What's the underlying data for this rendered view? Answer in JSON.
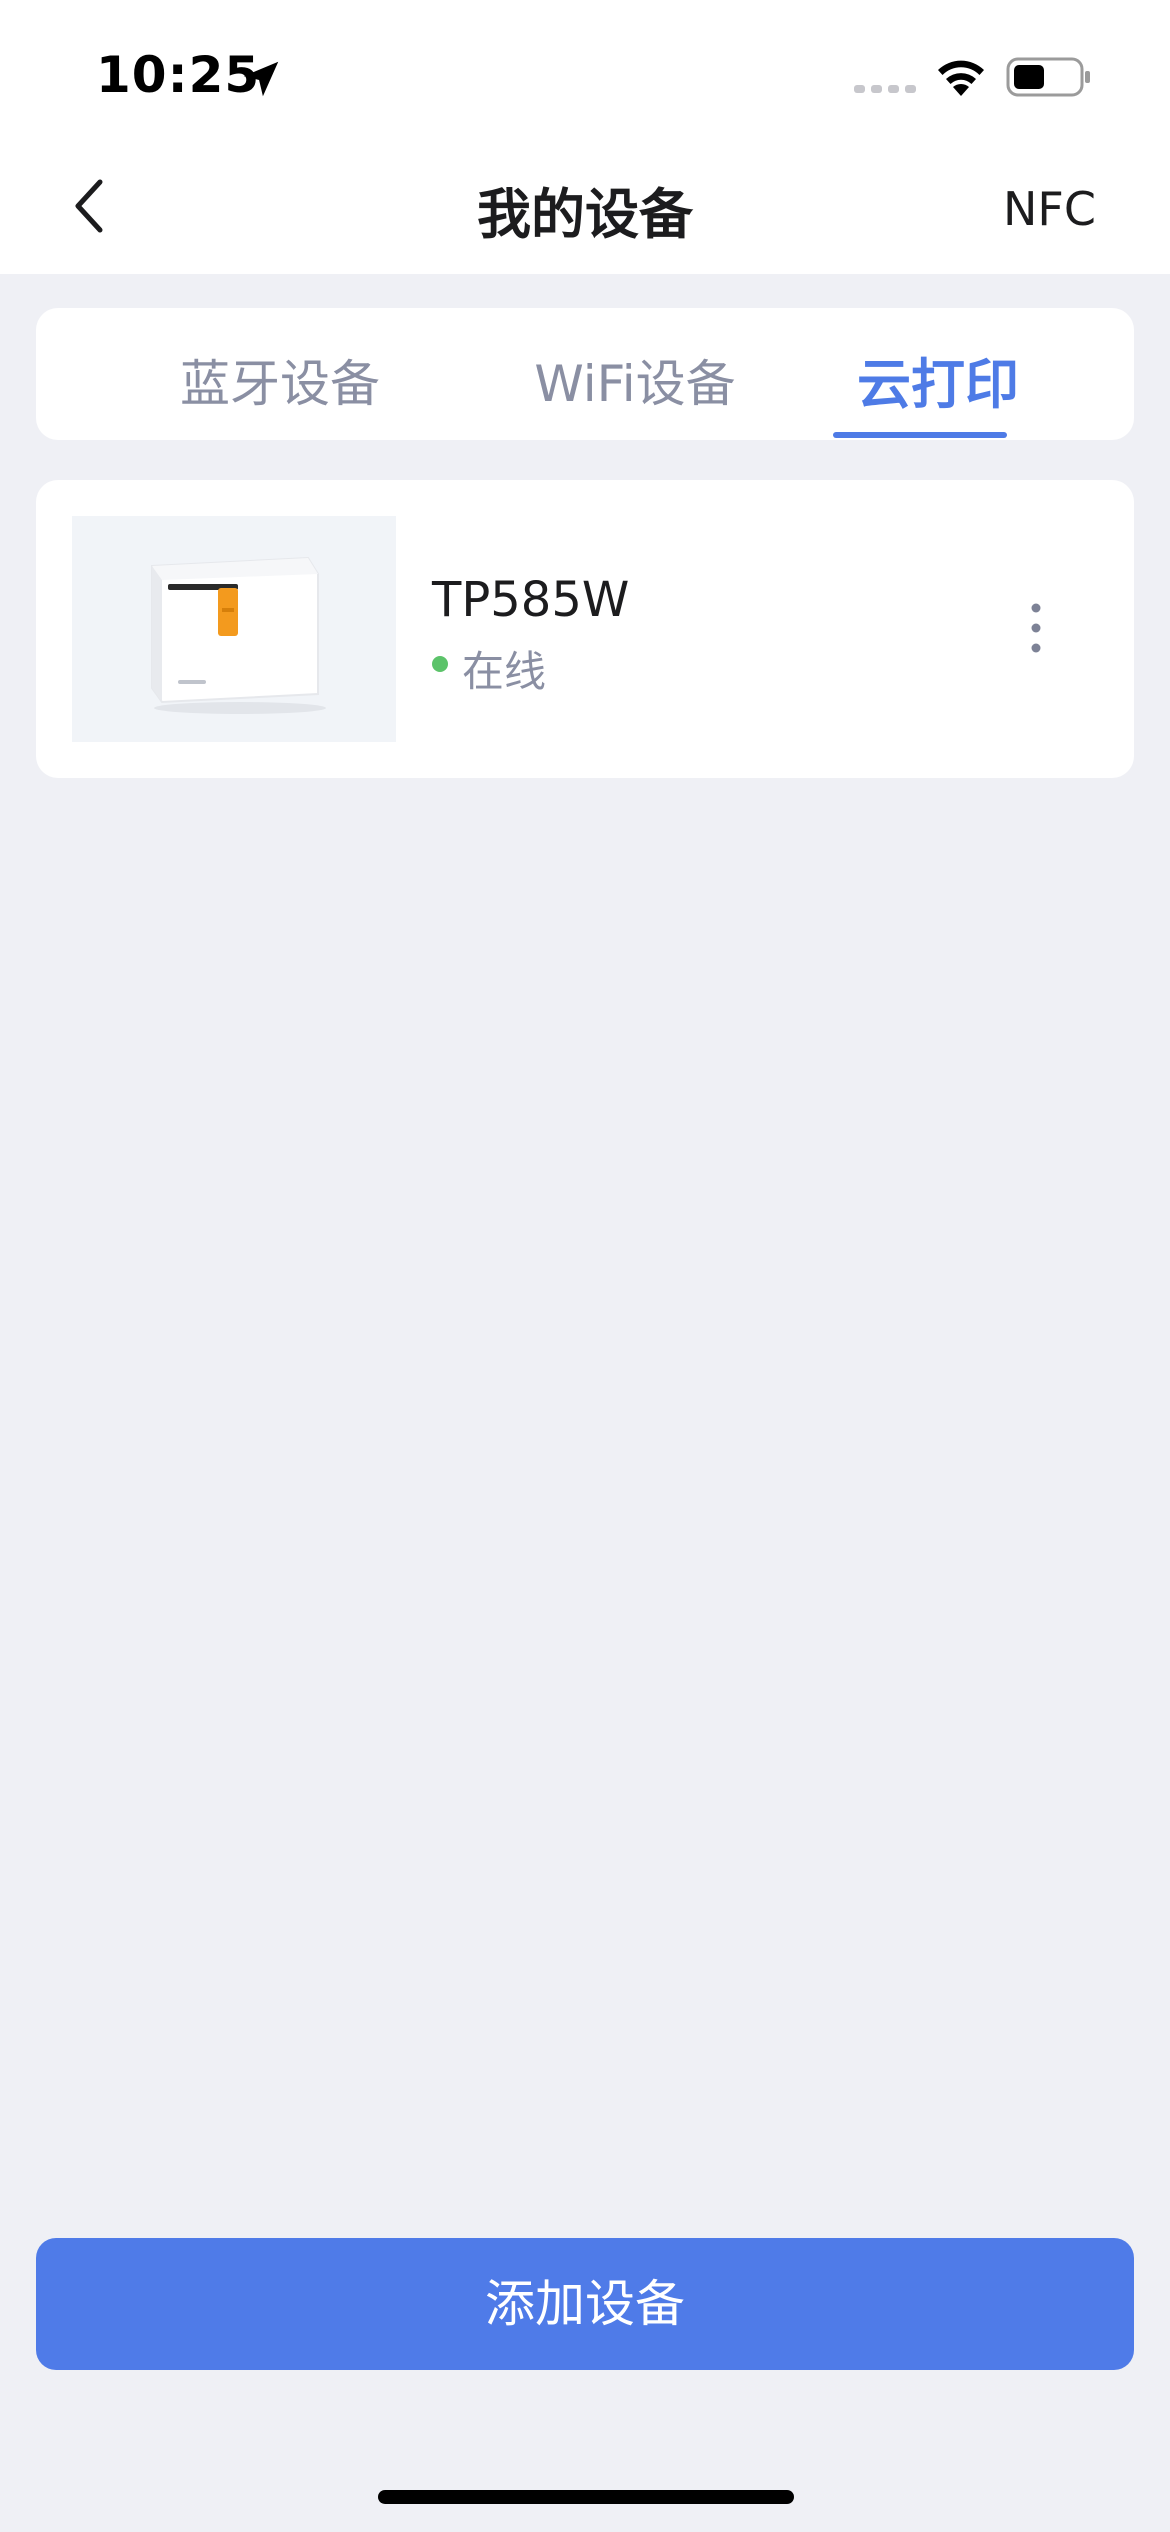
{
  "status_bar": {
    "time": "10:25",
    "icons": [
      "location-arrow-icon",
      "signal-icon",
      "wifi-icon",
      "battery-icon"
    ]
  },
  "nav": {
    "title": "我的设备",
    "right_action": "NFC",
    "back_icon": "chevron-left-icon"
  },
  "tabs": [
    {
      "label": "蓝牙设备",
      "active": false
    },
    {
      "label": "WiFi设备",
      "active": false
    },
    {
      "label": "云打印",
      "active": true
    }
  ],
  "devices": [
    {
      "name": "TP585W",
      "status": "在线",
      "status_color": "#5cc36a",
      "thumbnail": "printer-image",
      "menu_icon": "more-vertical-icon"
    }
  ],
  "add_button": {
    "label": "添加设备"
  },
  "colors": {
    "accent": "#4e7be6",
    "button": "#4f7be8",
    "background": "#eff0f5",
    "inactive_tab": "#8a8fa3"
  }
}
